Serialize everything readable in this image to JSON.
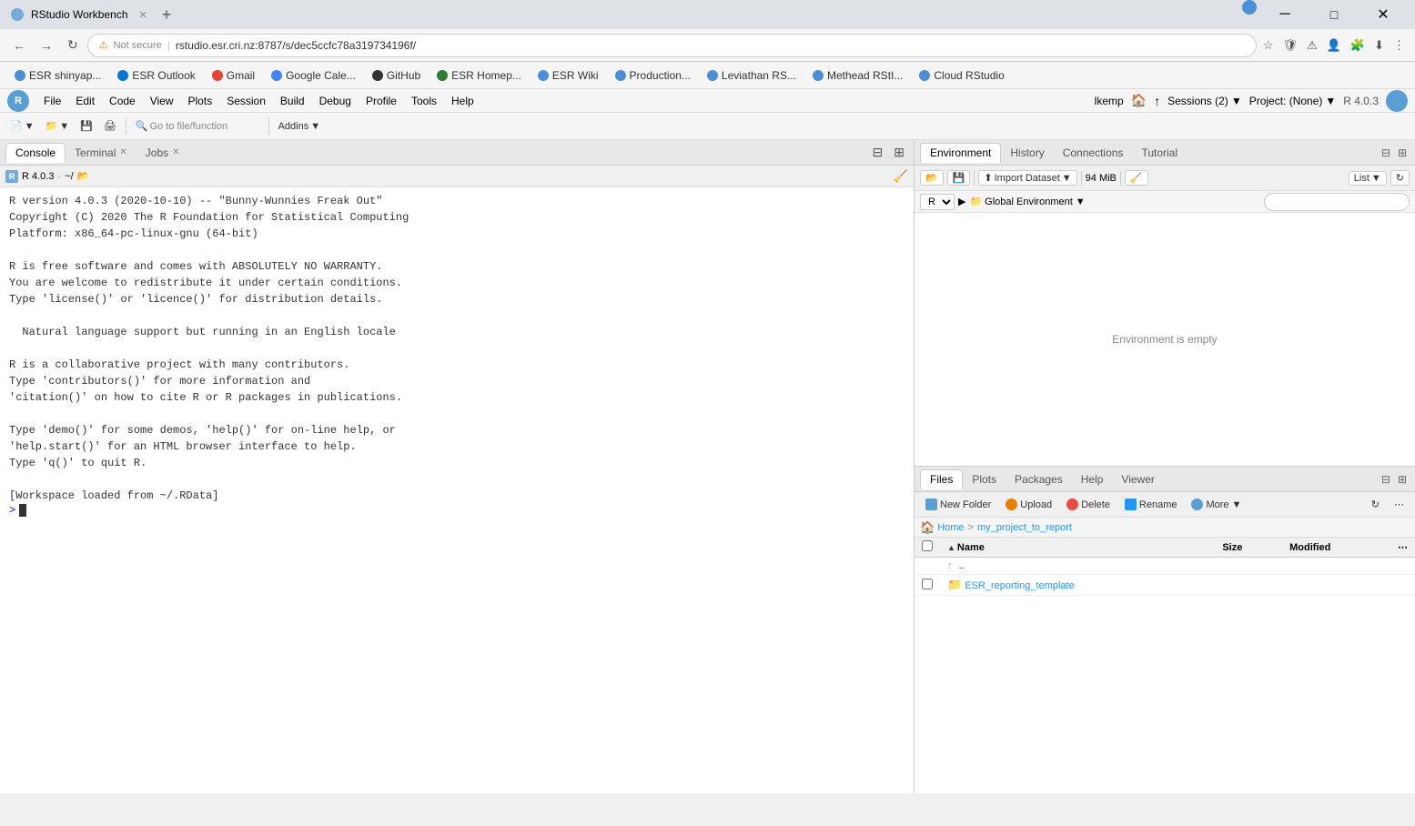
{
  "window": {
    "title": "RStudio Workbench",
    "minimize_label": "─",
    "maximize_label": "□",
    "close_label": "✕"
  },
  "browser": {
    "tab_title": "RStudio Workbench",
    "tab_favicon": "R",
    "address": "rstudio.esr.cri.nz:8787/s/dec5ccfc78a319734196f/",
    "warning": "Not secure",
    "new_tab": "+"
  },
  "bookmarks": [
    {
      "label": "ESR shinyap...",
      "favicon_color": "#4A90D9"
    },
    {
      "label": "ESR Outlook",
      "favicon_color": "#0078D4"
    },
    {
      "label": "Gmail",
      "favicon_color": "#EA4335"
    },
    {
      "label": "Google Cale...",
      "favicon_color": "#4285F4"
    },
    {
      "label": "GitHub",
      "favicon_color": "#333"
    },
    {
      "label": "ESR Homep...",
      "favicon_color": "#2E7D32"
    },
    {
      "label": "ESR Wiki",
      "favicon_color": "#4A90D9"
    },
    {
      "label": "Production...",
      "favicon_color": "#4A90D9"
    },
    {
      "label": "Leviathan RS...",
      "favicon_color": "#4A90D9"
    },
    {
      "label": "Methead RStI...",
      "favicon_color": "#4A90D9"
    },
    {
      "label": "Cloud RStudio",
      "favicon_color": "#4A90D9"
    }
  ],
  "rstudio": {
    "menu": [
      "File",
      "Edit",
      "Code",
      "View",
      "Plots",
      "Session",
      "Build",
      "Debug",
      "Profile",
      "Tools",
      "Help"
    ],
    "user": "lkemp",
    "sessions": "Sessions (2)",
    "project": "Project: (None)",
    "r_version": "R 4.0.3",
    "toolbar": {
      "new_file": "📄",
      "open": "📁",
      "save": "💾",
      "go_to_file": "Go to file/function",
      "addins": "Addins"
    }
  },
  "left_panel": {
    "tabs": [
      {
        "label": "Console",
        "active": true
      },
      {
        "label": "Terminal",
        "closeable": true
      },
      {
        "label": "Jobs",
        "closeable": true
      }
    ],
    "console": {
      "r_version_label": "R 4.0.3",
      "r_path": "~/",
      "output": "R version 4.0.3 (2020-10-10) -- \"Bunny-Wunnies Freak Out\"\nCopyright (C) 2020 The R Foundation for Statistical Computing\nPlatform: x86_64-pc-linux-gnu (64-bit)\n\nR is free software and comes with ABSOLUTELY NO WARRANTY.\nYou are welcome to redistribute it under certain conditions.\nType 'license()' or 'licence()' for distribution details.\n\n  Natural language support but running in an English locale\n\nR is a collaborative project with many contributors.\nType 'contributors()' for more information and\n'citation()' on how to cite R or R packages in publications.\n\nType 'demo()' for some demos, 'help()' for on-line help, or\n'help.start()' for an HTML browser interface to help.\nType 'q()' to quit R.\n\n[Workspace loaded from ~/.RData]",
      "prompt": ">"
    }
  },
  "right_top_panel": {
    "tabs": [
      "Environment",
      "History",
      "Connections",
      "Tutorial"
    ],
    "active_tab": "Environment",
    "toolbar": {
      "load_workspace": "📂",
      "save_workspace": "💾",
      "import_dataset": "Import Dataset",
      "memory": "94 MiB",
      "clear": "🧹",
      "list_view": "List",
      "refresh": "↻"
    },
    "env_selector": "R",
    "global_env": "Global Environment",
    "empty_message": "Environment is empty",
    "search_placeholder": ""
  },
  "right_bottom_panel": {
    "tabs": [
      "Files",
      "Plots",
      "Packages",
      "Help",
      "Viewer"
    ],
    "active_tab": "Files",
    "toolbar": {
      "new_folder": "New Folder",
      "upload": "Upload",
      "delete": "Delete",
      "rename": "Rename",
      "more": "More"
    },
    "breadcrumb": {
      "home": "Home",
      "separator": ">",
      "path": "my_project_to_report"
    },
    "columns": [
      "Name",
      "Size",
      "Modified"
    ],
    "files": [
      {
        "name": "..",
        "type": "parent",
        "size": "",
        "modified": ""
      },
      {
        "name": "ESR_reporting_template",
        "type": "folder",
        "size": "",
        "modified": ""
      }
    ]
  }
}
